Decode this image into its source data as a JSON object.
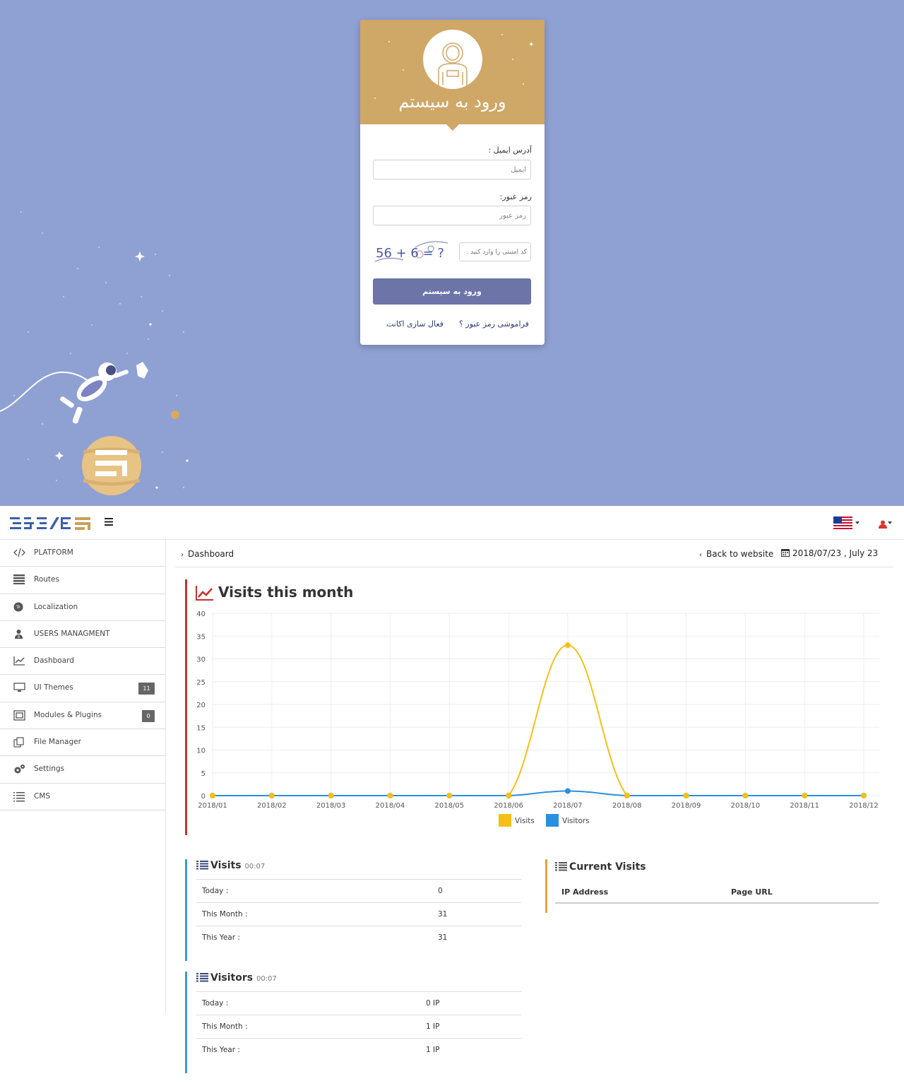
{
  "login": {
    "title": "ورود به سیستم",
    "email_label": "آدرس ایمیل :",
    "email_placeholder": "ایمیل",
    "password_label": "رمز عبور:",
    "password_placeholder": "رمز عبور",
    "captcha_text": "56 + 6 = ?",
    "captcha_placeholder": "کد امنیتی را وارد کنید .",
    "submit_label": "ورود به سیستم",
    "forgot_link": "فراموشی رمز عبور ؟",
    "activate_link": "فعال سازی اکانت",
    "colors": {
      "background": "#8fa1d3",
      "header": "#cfa767",
      "button": "#6c74a8"
    }
  },
  "topbar": {
    "menu_icon": "hamburger-icon",
    "language_icon": "us-flag-icon",
    "user_icon": "user-icon"
  },
  "sidebar": {
    "items": [
      {
        "label": "PLATFORM",
        "icon": "code-icon"
      },
      {
        "label": "Routes",
        "icon": "routes-icon"
      },
      {
        "label": "Localization",
        "icon": "globe-icon"
      },
      {
        "label": "USERS MANAGMENT",
        "icon": "users-icon"
      },
      {
        "label": "Dashboard",
        "icon": "chart-icon"
      },
      {
        "label": "UI Themes",
        "icon": "monitor-icon",
        "badge": "11"
      },
      {
        "label": "Modules & Plugins",
        "icon": "puzzle-icon",
        "badge": "0"
      },
      {
        "label": "File Manager",
        "icon": "files-icon"
      },
      {
        "label": "Settings",
        "icon": "gears-icon"
      },
      {
        "label": "CMS",
        "icon": "list-icon"
      }
    ]
  },
  "breadcrumb": {
    "current": "Dashboard",
    "back_link": "Back to website",
    "date": "2018/07/23 , July 23"
  },
  "chart": {
    "title": "Visits this month",
    "legend_visits": "Visits",
    "legend_visitors": "Visitors"
  },
  "chart_data": {
    "type": "line",
    "title": "Visits this month",
    "x": [
      "2018/01",
      "2018/02",
      "2018/03",
      "2018/04",
      "2018/05",
      "2018/06",
      "2018/07",
      "2018/08",
      "2018/09",
      "2018/10",
      "2018/11",
      "2018/12"
    ],
    "series": [
      {
        "name": "Visits",
        "color": "#f5c015",
        "values": [
          0,
          0,
          0,
          0,
          0,
          0,
          33,
          0,
          0,
          0,
          0,
          0
        ]
      },
      {
        "name": "Visitors",
        "color": "#2b8fe0",
        "values": [
          0,
          0,
          0,
          0,
          0,
          0,
          1,
          0,
          0,
          0,
          0,
          0
        ]
      }
    ],
    "ylim": [
      0,
      40
    ],
    "yticks": [
      0,
      5,
      10,
      15,
      20,
      25,
      30,
      35,
      40
    ],
    "grid": true,
    "legend": "bottom"
  },
  "visits_panel": {
    "title": "Visits",
    "time": "00:07",
    "rows": [
      {
        "label": "Today :",
        "value": "0"
      },
      {
        "label": "This Month :",
        "value": "31"
      },
      {
        "label": "This Year :",
        "value": "31"
      }
    ]
  },
  "visitors_panel": {
    "title": "Visitors",
    "time": "00:07",
    "rows": [
      {
        "label": "Today :",
        "value": "0 IP"
      },
      {
        "label": "This Month :",
        "value": "1 IP"
      },
      {
        "label": "This Year :",
        "value": "1 IP"
      }
    ]
  },
  "current_visits": {
    "title": "Current Visits",
    "columns": [
      "IP Address",
      "Page URL"
    ]
  }
}
